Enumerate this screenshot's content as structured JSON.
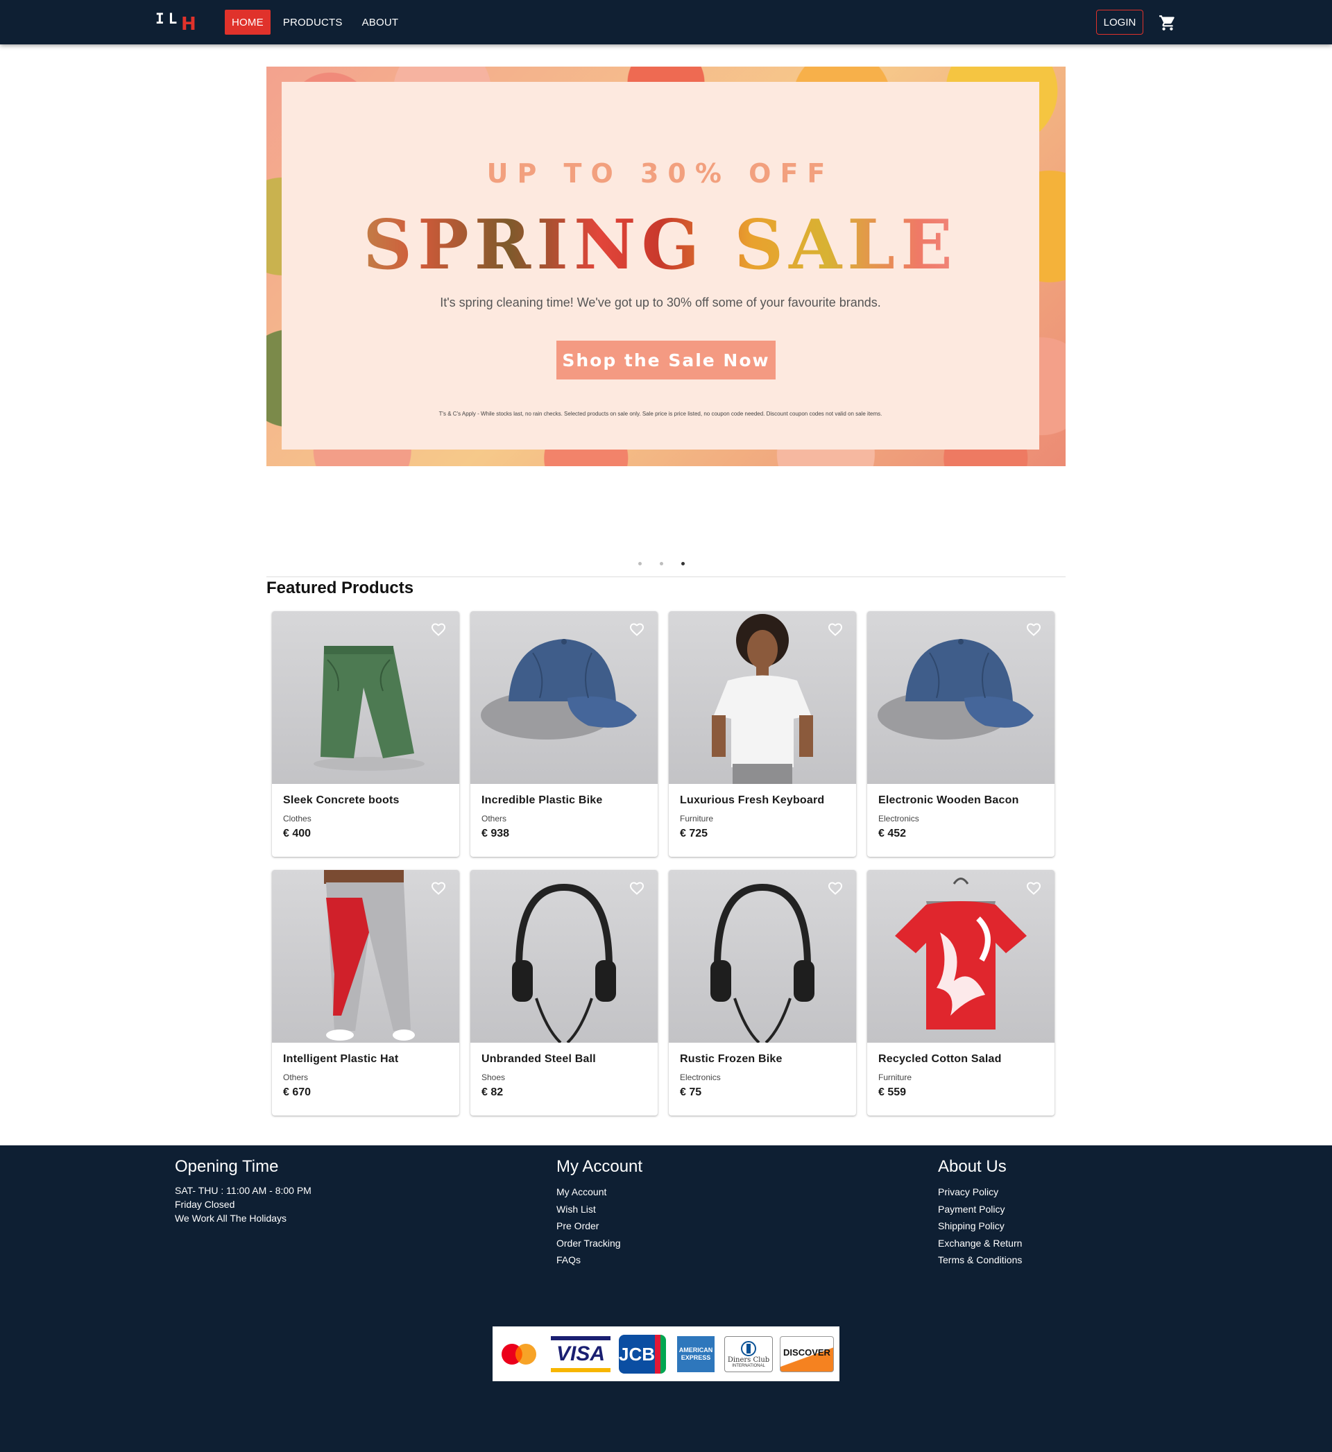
{
  "brand": {
    "logo_part1": "IL",
    "logo_part2": "H"
  },
  "nav": {
    "links": [
      {
        "label": "HOME",
        "active": true
      },
      {
        "label": "PRODUCTS",
        "active": false
      },
      {
        "label": "ABOUT",
        "active": false
      }
    ],
    "login_label": "LOGIN",
    "cart_icon": "shopping-cart-icon",
    "accent_color": "#e0322b",
    "bar_color": "#0e1f33"
  },
  "banner": {
    "promo_line": "UP TO 30% OFF",
    "title": "SPRING SALE",
    "subtitle": "It's spring cleaning time! We've got up to 30% off some of your favourite brands.",
    "cta_label": "Shop the Sale Now",
    "fine_print": "T's & C's Apply - While stocks last, no rain checks. Selected products on sale only. Sale price is price listed, no coupon code needed. Discount coupon codes not valid on sale items.",
    "slide_count": 3,
    "active_slide": 3
  },
  "featured": {
    "title": "Featured Products",
    "products": [
      {
        "name": "Sleek Concrete boots",
        "category": "Clothes",
        "price": "€ 400",
        "image": "green-shorts"
      },
      {
        "name": "Incredible Plastic Bike",
        "category": "Others",
        "price": "€ 938",
        "image": "blue-cap"
      },
      {
        "name": "Luxurious Fresh Keyboard",
        "category": "Furniture",
        "price": "€ 725",
        "image": "woman-white-tshirt"
      },
      {
        "name": "Electronic Wooden Bacon",
        "category": "Electronics",
        "price": "€ 452",
        "image": "blue-cap"
      },
      {
        "name": "Intelligent Plastic Hat",
        "category": "Others",
        "price": "€ 670",
        "image": "red-grey-joggers"
      },
      {
        "name": "Unbranded Steel Ball",
        "category": "Shoes",
        "price": "€ 82",
        "image": "headphones"
      },
      {
        "name": "Rustic Frozen Bike",
        "category": "Electronics",
        "price": "€ 75",
        "image": "headphones"
      },
      {
        "name": "Recycled Cotton Salad",
        "category": "Furniture",
        "price": "€ 559",
        "image": "red-floral-tshirt"
      }
    ]
  },
  "footer": {
    "opening": {
      "title": "Opening Time",
      "lines": [
        "SAT- THU : 11:00 AM - 8:00 PM",
        "Friday Closed",
        "We Work All The Holidays"
      ]
    },
    "account": {
      "title": "My Account",
      "links": [
        "My Account",
        "Wish List",
        "Pre Order",
        "Order Tracking",
        "FAQs"
      ]
    },
    "about": {
      "title": "About Us",
      "links": [
        "Privacy Policy",
        "Payment Policy",
        "Shipping Policy",
        "Exchange & Return",
        "Terms & Conditions"
      ]
    },
    "payments": {
      "visa": "VISA",
      "jcb": "JCB",
      "amex": "AMERICAN EXPRESS",
      "diners": "Diners Club",
      "diners_sub": "INTERNATIONAL",
      "discover": "DISCOVER"
    }
  }
}
